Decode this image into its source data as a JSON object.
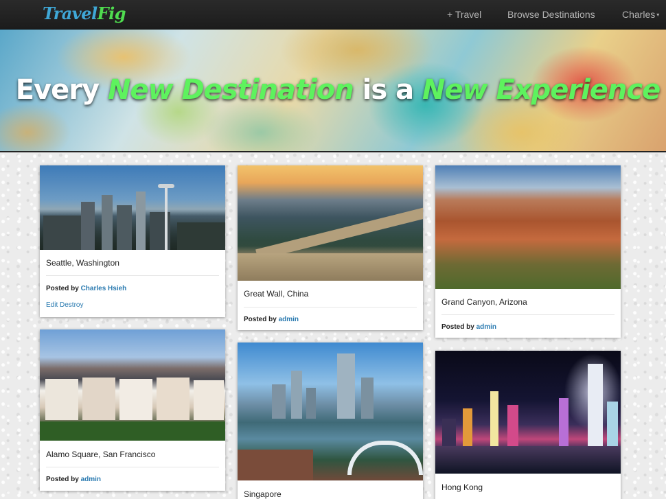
{
  "navbar": {
    "brand_part1": "Travel",
    "brand_part2": "Fig",
    "add_travel": "+ Travel",
    "browse": "Browse Destinations",
    "user": "Charles"
  },
  "hero": {
    "part1": "Every ",
    "part2": "New Destination",
    "part3": " is a ",
    "part4": "New Experience"
  },
  "posted_label": "Posted by",
  "cards": [
    {
      "title": "Seattle, Washington",
      "author": "Charles Hsieh",
      "edit": "Edit",
      "destroy": "Destroy"
    },
    {
      "title": "Great Wall, China",
      "author": "admin"
    },
    {
      "title": "Grand Canyon, Arizona",
      "author": "admin"
    },
    {
      "title": "Alamo Square, San Francisco",
      "author": "admin"
    },
    {
      "title": "Singapore"
    },
    {
      "title": "Hong Kong"
    }
  ],
  "colors": {
    "navbar": "#222222",
    "brand_blue": "#3fa7d6",
    "brand_green": "#4fdc4f",
    "hero_highlight": "#5ef25e",
    "link": "#2a7ab0"
  }
}
